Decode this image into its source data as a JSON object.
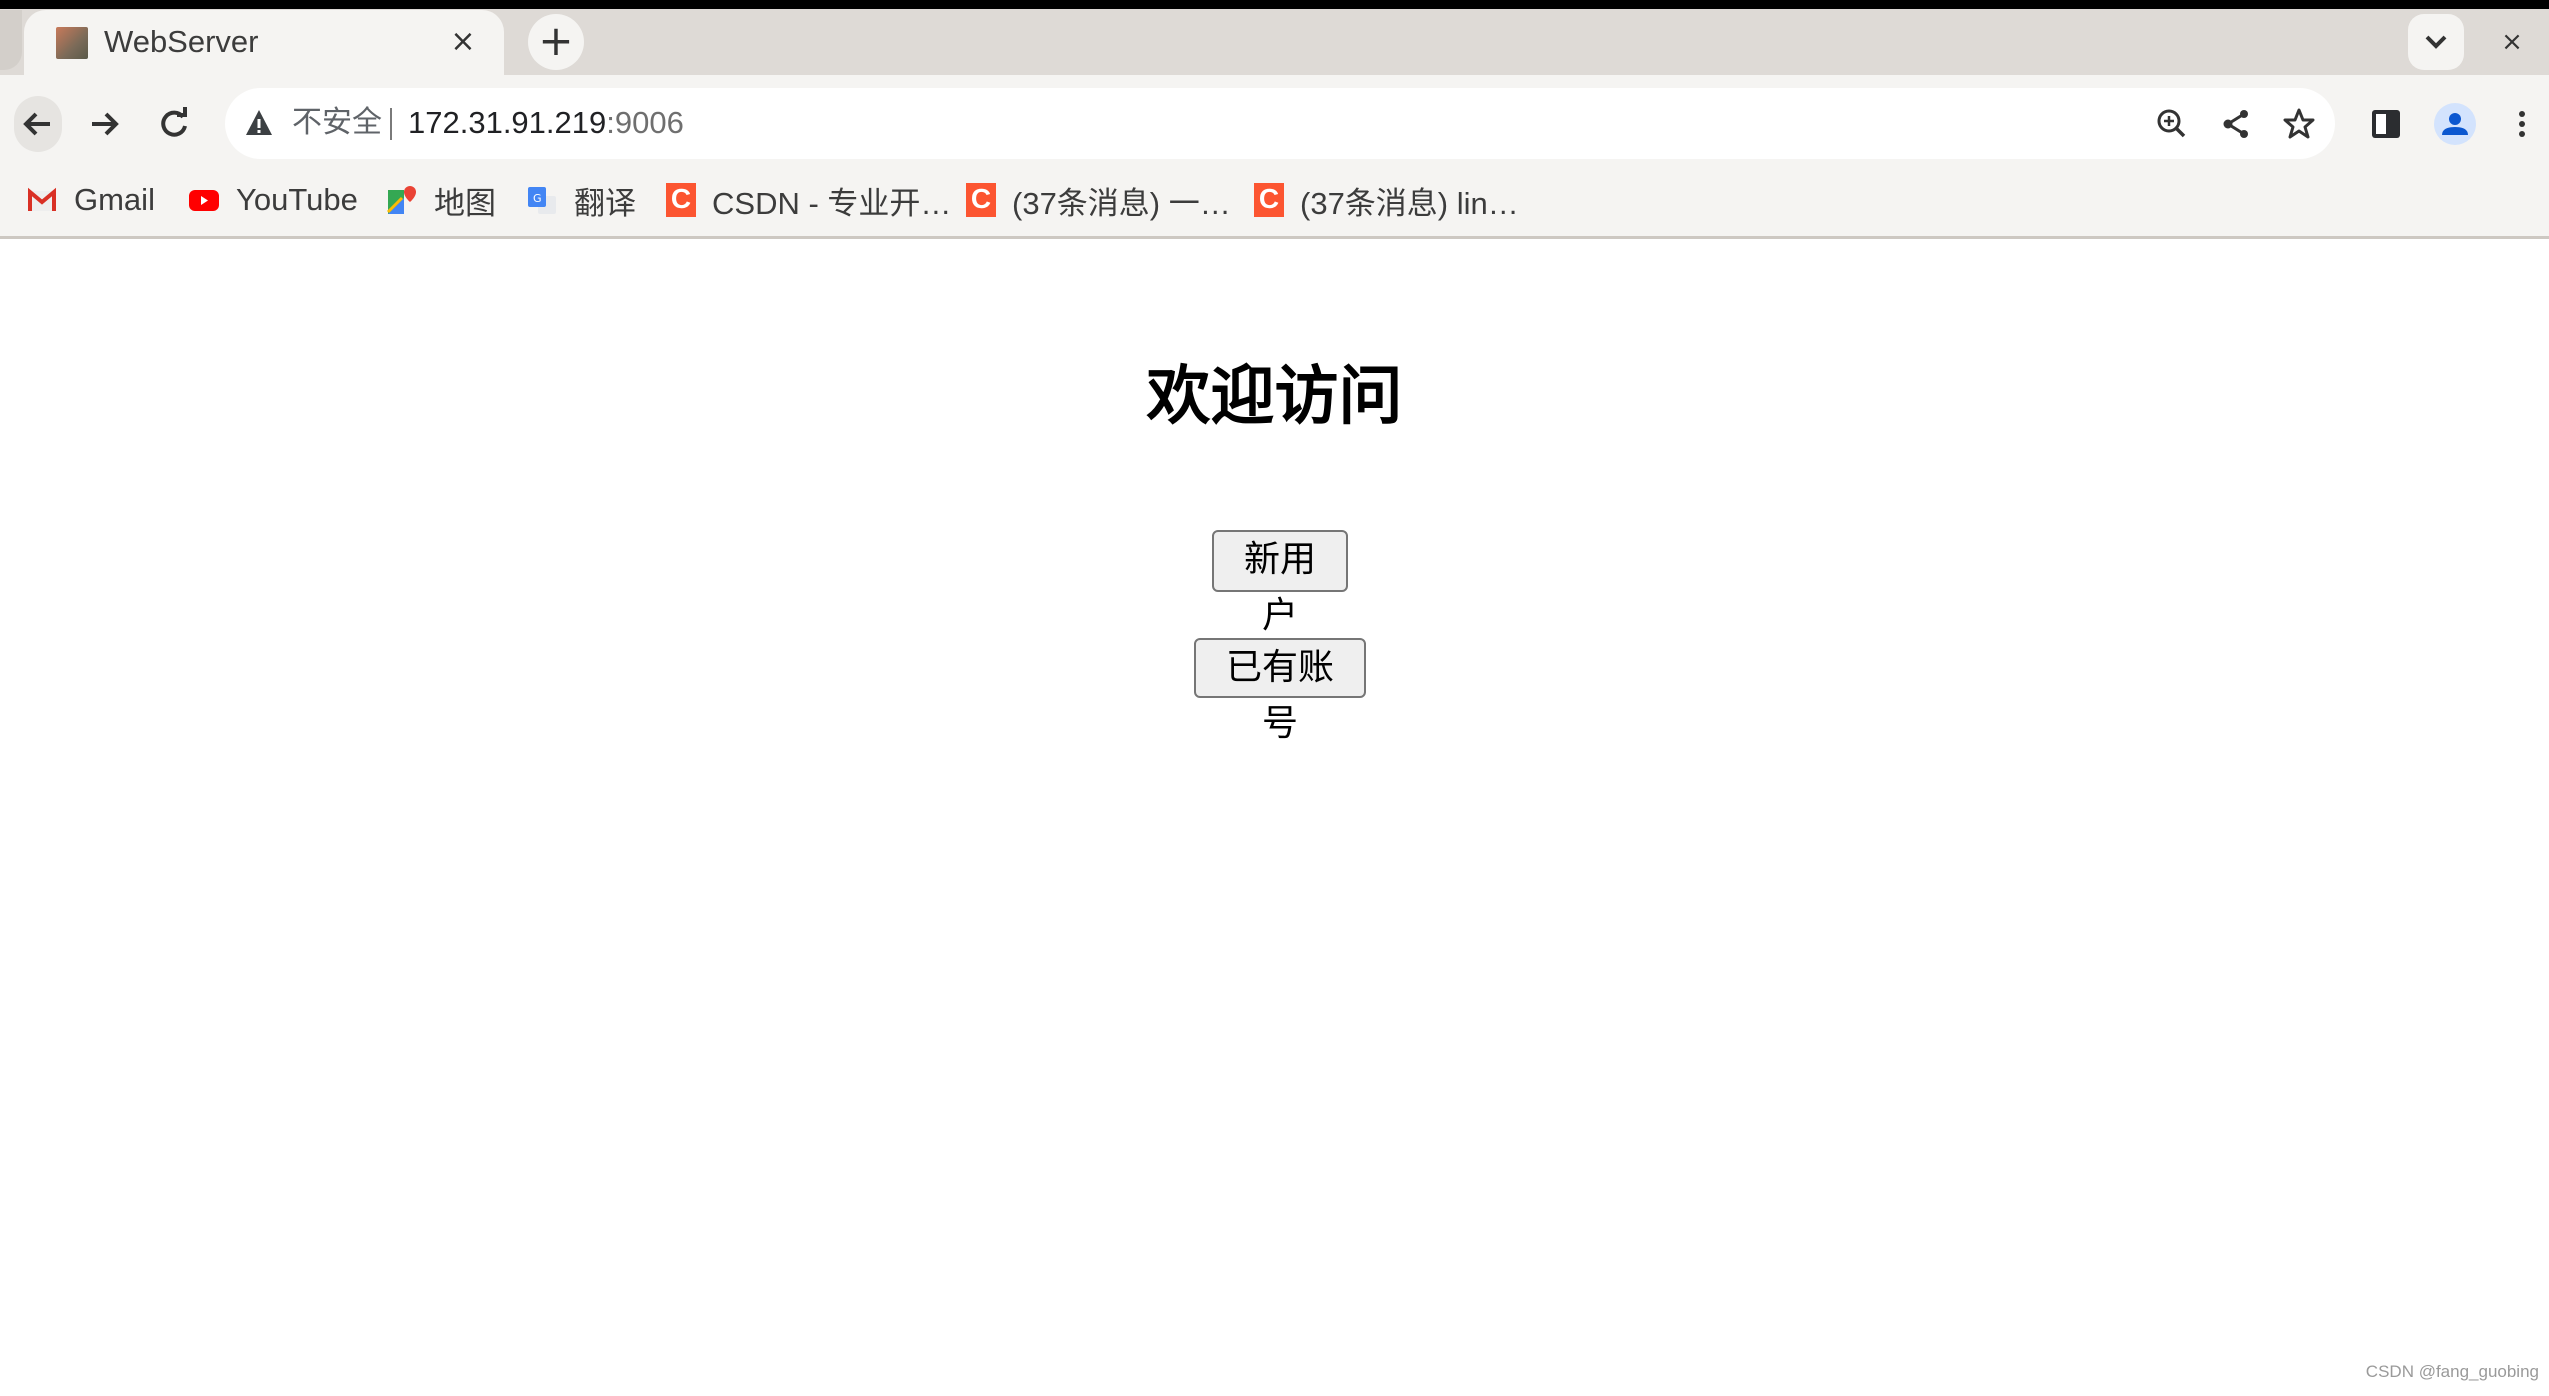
{
  "browser": {
    "tab": {
      "title": "WebServer",
      "favicon": "anime-avatar-favicon",
      "close_icon": "×"
    },
    "new_tab_icon": "+",
    "tab_search_icon": "chevron-down",
    "window_close_icon": "×",
    "nav": {
      "back_icon": "←",
      "forward_icon": "→",
      "reload_icon": "↻"
    },
    "omnibox": {
      "security_label": "不安全",
      "url_host": "172.31.91.219",
      "url_port": ":9006"
    },
    "toolbar_icons": [
      "zoom-icon",
      "share-icon",
      "bookmark-star-icon",
      "side-panel-icon",
      "profile-icon",
      "menu-icon"
    ],
    "bookmarks": [
      {
        "label": "Gmail",
        "icon": "gmail-icon"
      },
      {
        "label": "YouTube",
        "icon": "youtube-icon"
      },
      {
        "label": "地图",
        "icon": "maps-icon"
      },
      {
        "label": "翻译",
        "icon": "translate-icon"
      },
      {
        "label": "CSDN - 专业开…",
        "icon": "csdn-icon"
      },
      {
        "label": "(37条消息) 一…",
        "icon": "csdn-icon"
      },
      {
        "label": "(37条消息) lin…",
        "icon": "csdn-icon"
      }
    ],
    "csdn_icon_glyph": "C"
  },
  "page": {
    "heading": "欢迎访问",
    "buttons": {
      "new_user": "新用户",
      "existing_account": "已有账号"
    }
  },
  "watermark": "CSDN @fang_guobing",
  "colors": {
    "csdn": "#fc5531",
    "profile": "#0b57d0",
    "profile_bg": "#d3e3fd"
  }
}
